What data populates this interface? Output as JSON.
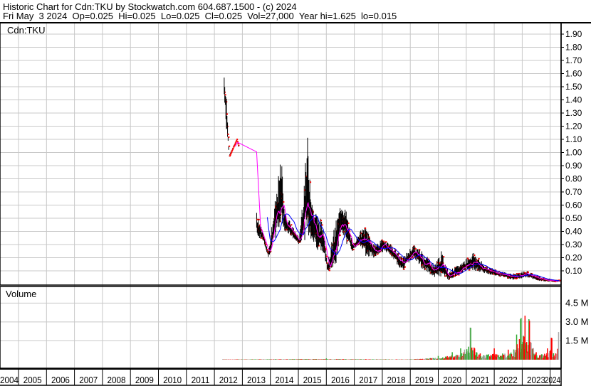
{
  "header": {
    "title": "Historic Chart for Cdn:TKU by Stockwatch.com 604.687.1500 - (c) 2024",
    "quote": "Fri May  3 2024  Op=0.025  Hi=0.025  Lo=0.025  Cl=0.025  Vol=27,000  Year hi=1.625  lo=0.015"
  },
  "colors": {
    "bar": "#000000",
    "close": "#ff0000",
    "ma_short": "#ff00ff",
    "ma_long": "#0000ff",
    "vol_up": "#33aa33",
    "vol_down": "#ff0000",
    "vol_flat": "#aaaaaa",
    "grid": "#c8c8c8"
  },
  "chart_data": [
    {
      "type": "line",
      "title": "Cdn:TKU",
      "ylabel": "",
      "ylim": [
        0,
        1.95
      ],
      "y_ticks": [
        "0.10",
        "0.20",
        "0.30",
        "0.40",
        "0.50",
        "0.60",
        "0.70",
        "0.80",
        "0.90",
        "1.00",
        "1.10",
        "1.20",
        "1.30",
        "1.40",
        "1.50",
        "1.60",
        "1.70",
        "1.80",
        "1.90"
      ],
      "grid": true,
      "series_points": [
        [
          2012.35,
          1.62,
          1.4
        ],
        [
          2012.43,
          1.45,
          1.17
        ],
        [
          2012.53,
          0.98,
          0.97
        ],
        [
          2012.79,
          1.1,
          1.1
        ],
        [
          2013.55,
          0.53,
          0.35
        ],
        [
          2013.75,
          0.38,
          0.33
        ],
        [
          2013.93,
          0.25,
          0.2
        ],
        [
          2014.39,
          0.98,
          0.45
        ],
        [
          2014.52,
          0.55,
          0.4
        ],
        [
          2014.77,
          0.45,
          0.35
        ],
        [
          2015.03,
          0.35,
          0.3
        ],
        [
          2015.33,
          1.13,
          0.35
        ],
        [
          2015.53,
          0.6,
          0.3
        ],
        [
          2015.92,
          0.45,
          0.2
        ],
        [
          2016.04,
          0.15,
          0.1
        ],
        [
          2016.3,
          0.45,
          0.1
        ],
        [
          2016.55,
          0.65,
          0.4
        ],
        [
          2016.73,
          0.55,
          0.3
        ],
        [
          2016.93,
          0.3,
          0.25
        ],
        [
          2017.19,
          0.4,
          0.3
        ],
        [
          2017.44,
          0.45,
          0.2
        ],
        [
          2017.7,
          0.3,
          0.2
        ],
        [
          2018.08,
          0.35,
          0.25
        ],
        [
          2018.33,
          0.3,
          0.2
        ],
        [
          2018.72,
          0.2,
          0.1
        ],
        [
          2019.1,
          0.3,
          0.2
        ],
        [
          2019.48,
          0.25,
          0.1
        ],
        [
          2019.86,
          0.15,
          0.05
        ],
        [
          2020.11,
          0.25,
          0.05
        ],
        [
          2020.37,
          0.1,
          0.03
        ],
        [
          2020.75,
          0.15,
          0.07
        ],
        [
          2021.01,
          0.2,
          0.1
        ],
        [
          2021.26,
          0.25,
          0.1
        ],
        [
          2021.64,
          0.15,
          0.08
        ],
        [
          2022.15,
          0.1,
          0.06
        ],
        [
          2022.66,
          0.08,
          0.03
        ],
        [
          2023.17,
          0.1,
          0.05
        ],
        [
          2023.68,
          0.05,
          0.02
        ],
        [
          2024.34,
          0.03,
          0.015
        ]
      ]
    },
    {
      "type": "bar",
      "title": "Volume",
      "ylim": [
        0,
        5.5
      ],
      "y_ticks": [
        "1.5 M",
        "3.0 M",
        "4.5 M"
      ],
      "y_tick_values": [
        1.5,
        3.0,
        4.5
      ],
      "volume_points_millions": [
        [
          2012.3,
          0.05
        ],
        [
          2016.0,
          0.1
        ],
        [
          2019.0,
          0.05
        ],
        [
          2020.0,
          0.3
        ],
        [
          2020.5,
          0.6
        ],
        [
          2020.8,
          0.9
        ],
        [
          2021.15,
          2.6
        ],
        [
          2021.5,
          0.5
        ],
        [
          2022.0,
          0.9
        ],
        [
          2022.5,
          0.8
        ],
        [
          2022.8,
          2.0
        ],
        [
          2022.95,
          3.3
        ],
        [
          2023.1,
          3.5
        ],
        [
          2023.25,
          3.2
        ],
        [
          2023.5,
          0.6
        ],
        [
          2023.9,
          0.9
        ],
        [
          2024.05,
          1.8
        ],
        [
          2024.2,
          0.5
        ],
        [
          2024.3,
          2.2
        ]
      ]
    }
  ],
  "x_axis": {
    "years": [
      "2004",
      "2005",
      "2006",
      "2007",
      "2008",
      "2009",
      "2010",
      "2011",
      "2012",
      "2013",
      "2014",
      "2015",
      "2016",
      "2017",
      "2018",
      "2019",
      "2020",
      "2021",
      "2022",
      "2023",
      "2024"
    ]
  }
}
